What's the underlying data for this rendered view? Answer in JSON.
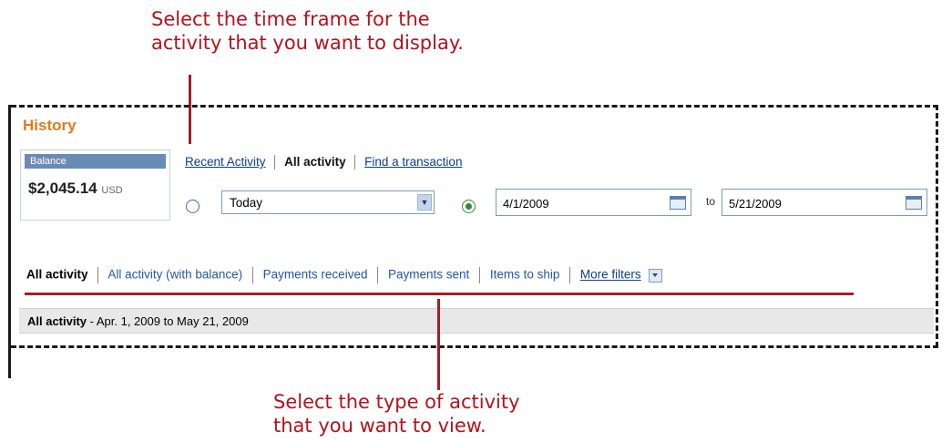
{
  "callouts": {
    "time_frame": [
      "Select the time frame for the",
      "activity that you want to display."
    ],
    "activity_type": [
      "Select the type of activity",
      "that you want to view."
    ]
  },
  "history": {
    "title": "History",
    "balance": {
      "label": "Balance",
      "amount": "$2,045.14",
      "currency": "USD"
    },
    "subnav": {
      "recent_activity": "Recent Activity",
      "all_activity": "All activity",
      "find_transaction": "Find a transaction"
    },
    "filter": {
      "period_select": "Today",
      "date_from": "4/1/2009",
      "to_label": "to",
      "date_to": "5/21/2009",
      "selected_option": "date-range"
    },
    "tabs": [
      "All activity",
      "All activity (with balance)",
      "Payments received",
      "Payments sent",
      "Items to ship",
      "More filters"
    ],
    "results": {
      "label": "All activity",
      "range": " - Apr. 1, 2009 to May 21, 2009"
    }
  },
  "colors": {
    "callout": "#b4121c",
    "history_title": "#e07b1e",
    "link": "#0d3f8a"
  }
}
